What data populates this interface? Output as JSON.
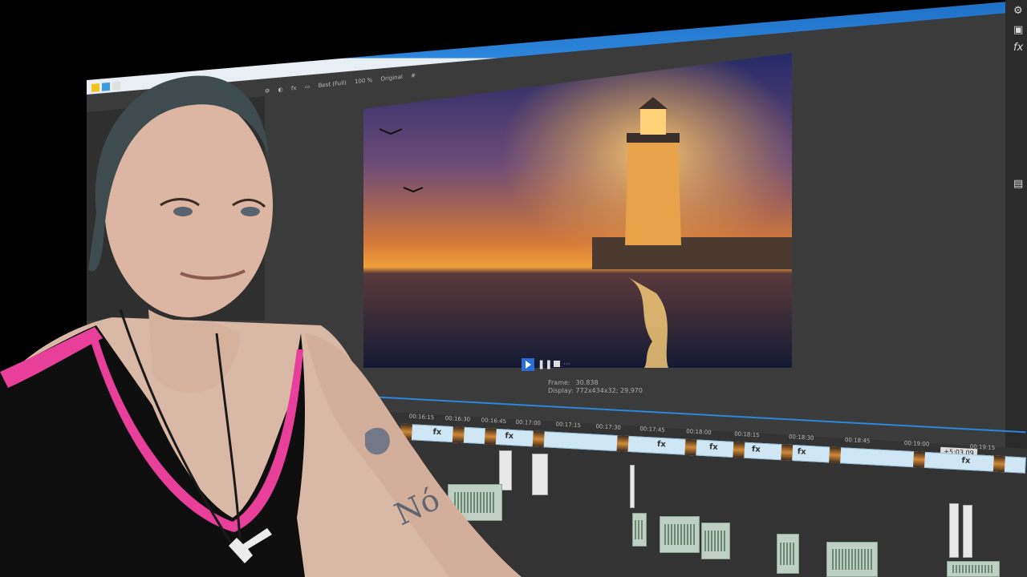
{
  "toolbar": {
    "preview_quality": "Best (Full)",
    "zoom": "100 %",
    "size_mode": "Original"
  },
  "preview": {
    "frame_label": "Frame:",
    "frame_value": "30.838",
    "display_label": "Display:",
    "display_value": "772x434x32; 29,970"
  },
  "timeline": {
    "ruler_ticks": [
      "00:16:15",
      "00:16:30",
      "00:16:45",
      "00:17:00",
      "00:17:15",
      "00:17:30",
      "00:17:45",
      "00:18:00",
      "00:18:15",
      "00:18:30",
      "00:18:45",
      "00:19:00",
      "00:19:15"
    ],
    "timecode_badge": "+5:03.09"
  },
  "colors": {
    "accent": "#2c86db",
    "play_button": "#2a6dd6",
    "video_clip": "#cfe6f4",
    "tank_top_trim": "#e8409a"
  },
  "icons": [
    "settings-icon",
    "fx-icon",
    "play-icon",
    "pause-icon",
    "stop-icon",
    "more-icon"
  ]
}
